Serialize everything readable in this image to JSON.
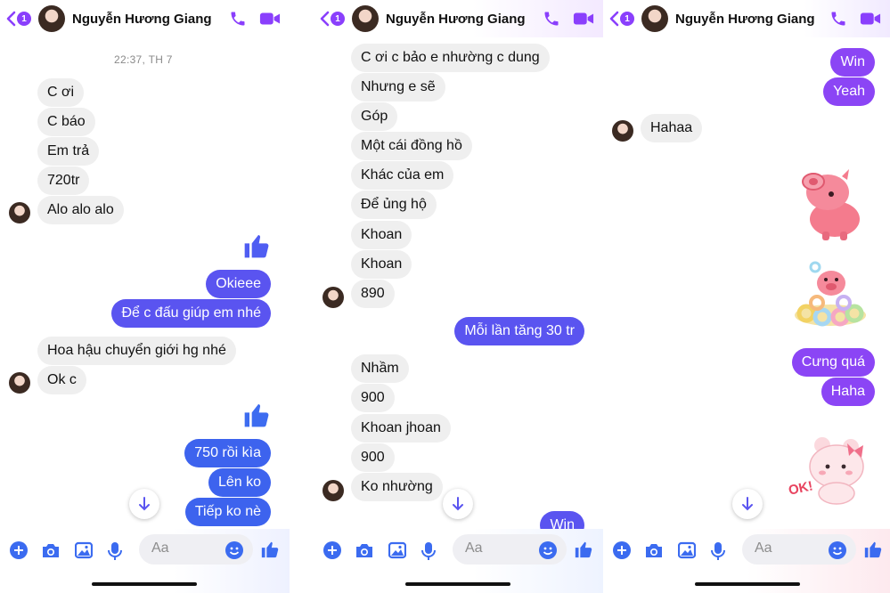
{
  "contact_name": "Nguyễn Hương Giang",
  "back_badge": "1",
  "composer_placeholder": "Aa",
  "colors": {
    "accent": "#8a3ffc",
    "incoming": "#efefef",
    "outgoing_blue": "#5a54f0",
    "outgoing_purple": "#8b45f5"
  },
  "panels": [
    {
      "timestamp": "22:37, TH 7",
      "incoming_1": [
        "C ơi",
        "C báo",
        "Em trả",
        "720tr",
        "Alo alo alo"
      ],
      "outgoing_1": [
        "Okieee",
        "Để c đấu giúp em nhé"
      ],
      "incoming_2": [
        "Hoa hậu chuyển giới hg nhé",
        "Ok c"
      ],
      "outgoing_2": [
        "750 rồi kìa",
        "Lên ko",
        "Tiếp ko nè"
      ]
    },
    {
      "incoming_1": [
        "C ơi c bảo e nhường c dung",
        "Nhưng e sẽ",
        "Góp",
        "Một cái đồng hồ",
        "Khác của em",
        "Để ủng hộ",
        "Khoan",
        "Khoan",
        "890"
      ],
      "outgoing_1": [
        "Mỗi lần tăng 30 tr"
      ],
      "incoming_2": [
        "Nhầm",
        "900",
        "Khoan jhoan",
        "900",
        "Ko nhường"
      ],
      "outgoing_2": [
        "Win"
      ]
    },
    {
      "outgoing_1": [
        "Win",
        "Yeah"
      ],
      "incoming_1": [
        "Hahaa"
      ],
      "outgoing_2": [
        "Cưng quá",
        "Haha"
      ],
      "sticker_text": "OK!"
    }
  ]
}
